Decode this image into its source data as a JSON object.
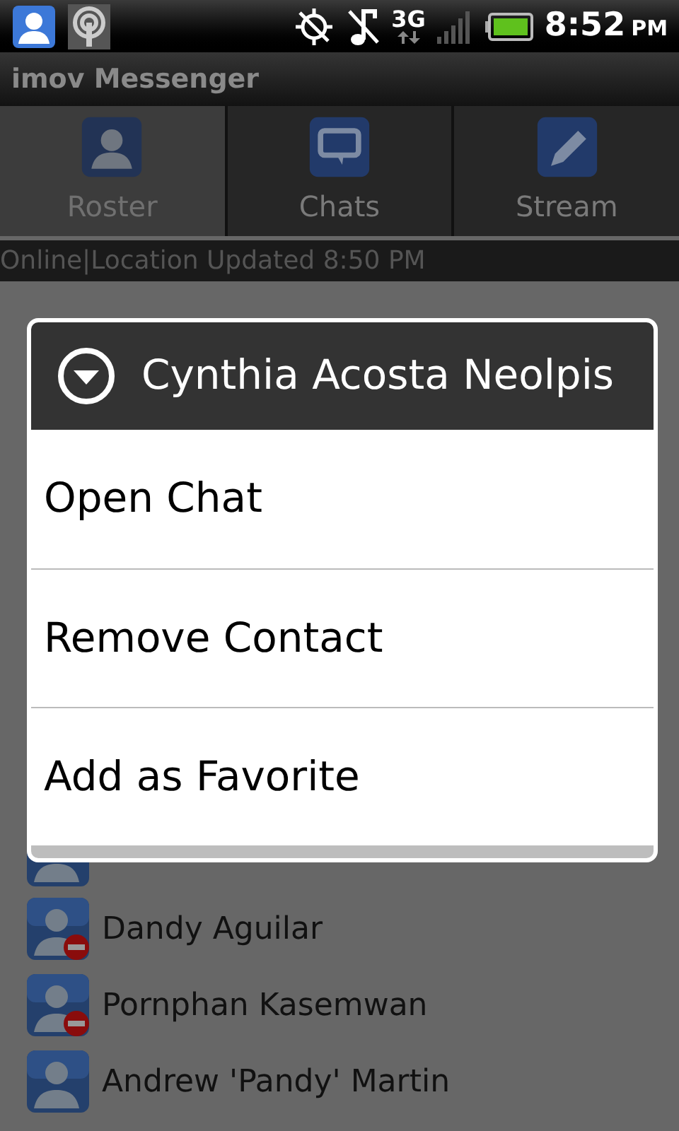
{
  "status_bar": {
    "network": "3G",
    "time": "8:52",
    "meridiem": "PM"
  },
  "app_title": "imov Messenger",
  "tabs": [
    {
      "label": "Roster",
      "selected": true
    },
    {
      "label": "Chats",
      "selected": false
    },
    {
      "label": "Stream",
      "selected": false
    }
  ],
  "presence_line": "Online|Location Updated 8:50 PM",
  "contacts": [
    {
      "name": "Dandy Aguilar",
      "busy": true
    },
    {
      "name": "Pornphan Kasemwan",
      "busy": true
    },
    {
      "name": "Andrew 'Pandy' Martin",
      "busy": false
    }
  ],
  "dialog": {
    "title": "Cynthia Acosta Neolpis",
    "items": [
      "Open Chat",
      "Remove Contact",
      "Add as Favorite"
    ]
  }
}
